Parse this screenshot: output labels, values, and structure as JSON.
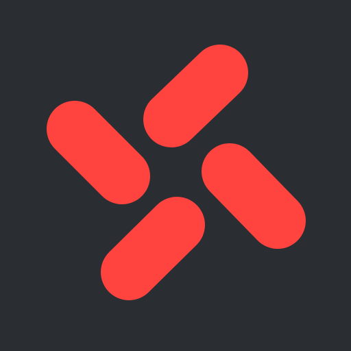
{
  "logo": {
    "background_color": "#2a2d32",
    "mark_color": "#ff433f",
    "icon_name": "four-pill-pinwheel-logo-icon"
  }
}
